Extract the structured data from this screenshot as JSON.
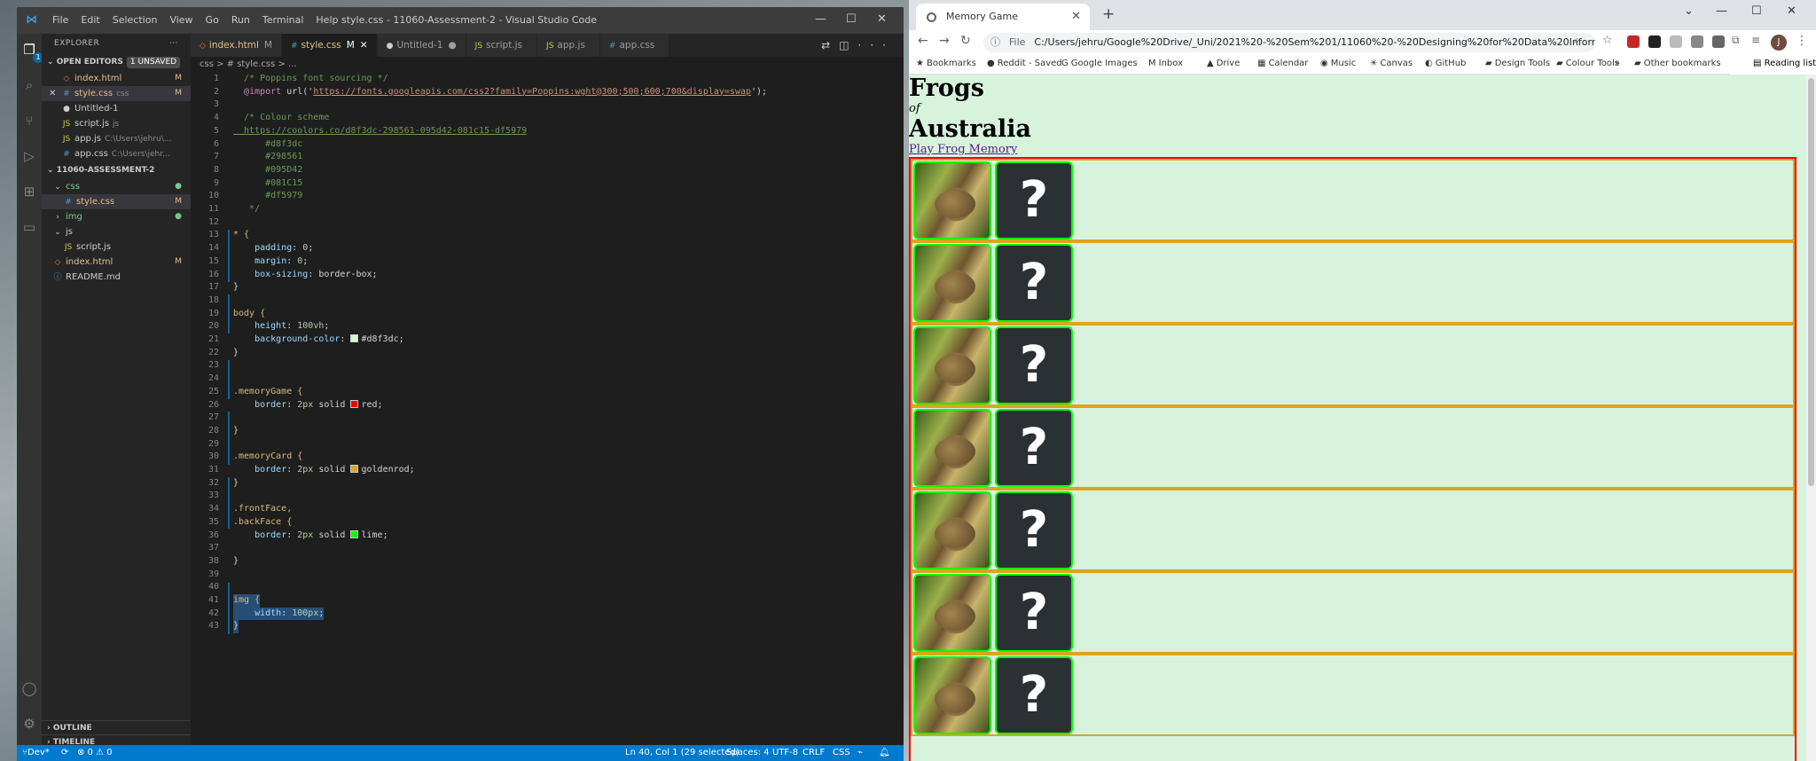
{
  "vscode": {
    "title": "style.css - 11060-Assessment-2 - Visual Studio Code",
    "menu": [
      "File",
      "Edit",
      "Selection",
      "View",
      "Go",
      "Run",
      "Terminal",
      "Help"
    ],
    "explorer_label": "EXPLORER",
    "open_editors_label": "OPEN EDITORS",
    "unsaved_badge": "1 UNSAVED",
    "open_editors": [
      {
        "name": "index.html",
        "path": "",
        "mark": "M",
        "icon": "html"
      },
      {
        "name": "style.css",
        "path": "css",
        "mark": "M",
        "icon": "css",
        "selected": true
      },
      {
        "name": "Untitled-1",
        "path": "",
        "mark": "",
        "icon": "file"
      },
      {
        "name": "script.js",
        "path": "js",
        "mark": "",
        "icon": "js"
      },
      {
        "name": "app.js",
        "path": "C:\\Users\\jehru\\...",
        "mark": "",
        "icon": "js"
      },
      {
        "name": "app.css",
        "path": "C:\\Users\\jehr...",
        "mark": "",
        "icon": "css"
      }
    ],
    "project_label": "11060-ASSESSMENT-2",
    "tree": [
      {
        "name": "css",
        "indent": 0,
        "icon": "chevron-down",
        "mark": "●"
      },
      {
        "name": "style.css",
        "indent": 1,
        "icon": "css",
        "mark": "M",
        "selected": true
      },
      {
        "name": "img",
        "indent": 0,
        "icon": "chevron-right",
        "mark": "●"
      },
      {
        "name": "js",
        "indent": 0,
        "icon": "chevron-down",
        "mark": ""
      },
      {
        "name": "script.js",
        "indent": 1,
        "icon": "js",
        "mark": ""
      },
      {
        "name": "index.html",
        "indent": 0,
        "icon": "html",
        "mark": "M"
      },
      {
        "name": "README.md",
        "indent": 0,
        "icon": "info",
        "mark": ""
      }
    ],
    "outline_label": "OUTLINE",
    "timeline_label": "TIMELINE",
    "tabs": [
      {
        "label": "index.html",
        "suffix": "M",
        "icon": "html"
      },
      {
        "label": "style.css",
        "suffix": "M",
        "icon": "css",
        "active": true
      },
      {
        "label": "Untitled-1",
        "suffix": "●",
        "icon": "file"
      },
      {
        "label": "script.js",
        "suffix": "",
        "icon": "js"
      },
      {
        "label": "app.js",
        "suffix": "",
        "icon": "js"
      },
      {
        "label": "app.css",
        "suffix": "",
        "icon": "css"
      }
    ],
    "breadcrumb": "css > # style.css > ...",
    "code_lines": [
      "  /* Poppins font sourcing */",
      "  @import url('https://fonts.googleapis.com/css2?family=Poppins:wght@300;500;600;700&display=swap');",
      "",
      "  /* Colour scheme",
      "  https://coolors.co/d8f3dc-298561-095d42-081c15-df5979",
      "      #d8f3dc",
      "      #298561",
      "      #095D42",
      "      #081C15",
      "      #df5979",
      "   */",
      "",
      "* {",
      "    padding: 0;",
      "    margin: 0;",
      "    box-sizing: border-box;",
      "}",
      "",
      "body {",
      "    height: 100vh;",
      "    background-color: #d8f3dc;",
      "}",
      "",
      "",
      ".memoryGame {",
      "    border: 2px solid red;",
      "",
      "}",
      "",
      ".memoryCard {",
      "    border: 2px solid goldenrod;",
      "}",
      "",
      ".frontFace,",
      ".backFace {",
      "    border: 2px solid lime;",
      "",
      "}",
      "",
      "",
      "img {",
      "    width: 100px;",
      "}"
    ],
    "status": {
      "branch": "Dev*",
      "problems": "⊗ 0 ⚠ 0",
      "position": "Ln 40, Col 1 (29 selected)",
      "spaces": "Spaces: 4",
      "encoding": "UTF-8",
      "eol": "CRLF",
      "language": "CSS"
    }
  },
  "browser": {
    "tab_title": "Memory Game",
    "url_prefix": "File",
    "url": "C:/Users/jehru/Google%20Drive/_Uni/2021%20-%20Sem%201/11060%20-%20Designing%20for%20Data%20Informed%20U...",
    "bookmarks": [
      "Bookmarks",
      "Reddit - Saved",
      "Google Images",
      "Inbox",
      "Drive",
      "Calendar",
      "Music",
      "Canvas",
      "GitHub",
      "Design Tools",
      "Colour Tools"
    ],
    "other_bookmarks": "Other bookmarks",
    "reading_list": "Reading list",
    "profile_initial": "J",
    "colors": {
      "page_bg": "#d8f3dc",
      "game_border": "red",
      "card_border": "goldenrod",
      "face_border": "lime"
    }
  },
  "page": {
    "title_line1": "Frogs",
    "title_of": "of",
    "title_line2": "Australia",
    "link": "Play Frog Memory",
    "card_count": 7,
    "back_symbol": "?"
  }
}
